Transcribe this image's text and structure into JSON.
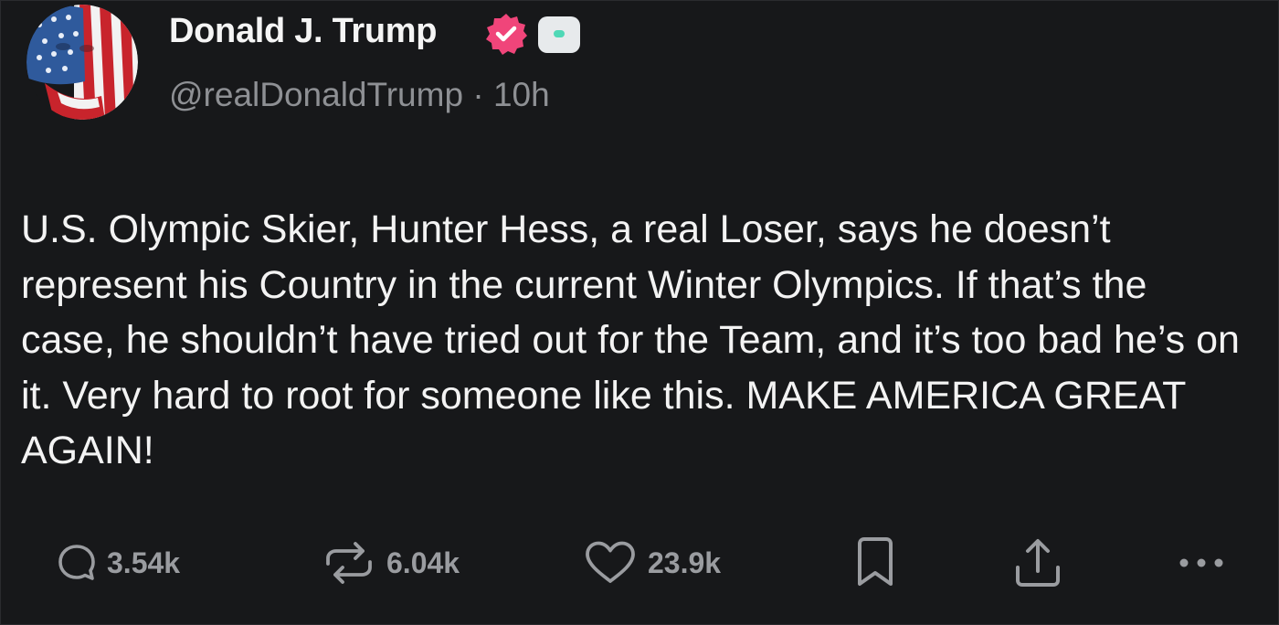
{
  "post": {
    "author": {
      "display_name": "Donald J. Trump",
      "handle": "@realDonaldTrump",
      "separator": "·",
      "time": "10h",
      "avatar_icon": "avatar-image",
      "verified_icon": "verified-badge-icon",
      "affiliate_icon": "affiliate-badge-icon"
    },
    "text": "U.S. Olympic Skier, Hunter Hess, a real Loser, says he doesn’t represent his Country in the current Winter Olympics. If that’s the case, he shouldn’t have tried out for the Team, and it’s too bad he’s on it. Very hard to root for someone like this. MAKE AMERICA GREAT AGAIN!",
    "actions": {
      "replies": "3.54k",
      "reposts": "6.04k",
      "likes": "23.9k"
    }
  },
  "colors": {
    "background": "#17181a",
    "text": "#f3f3f3",
    "muted": "#8e9094",
    "verified_badge": "#f0457a",
    "affiliate_badge": "#e7eaec"
  }
}
